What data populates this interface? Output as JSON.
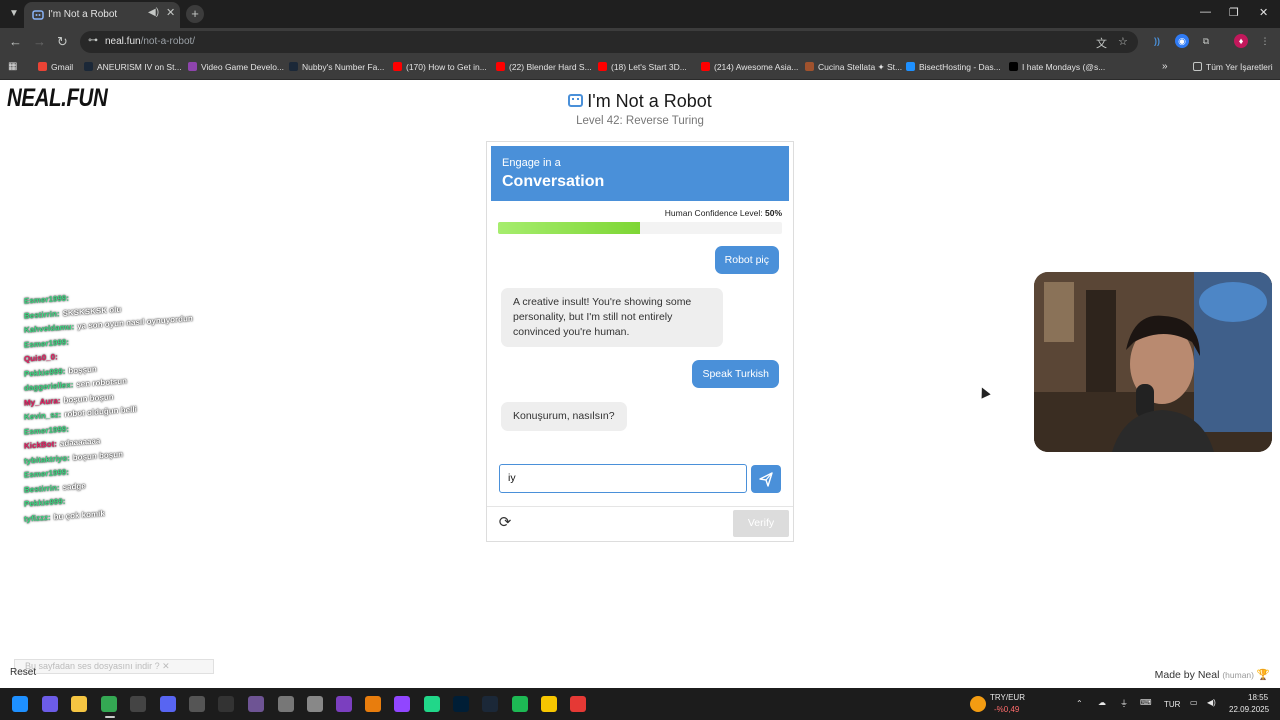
{
  "browser": {
    "tab": {
      "title": "I'm Not a Robot",
      "audio_icon": "speaker-icon",
      "close": "✕",
      "new_tab": "+"
    },
    "url": {
      "host": "neal.fun",
      "path": "/not-a-robot/"
    },
    "bookmarks": [
      {
        "label": "Gmail",
        "color": "#ea4335"
      },
      {
        "label": "ANEURISM IV on St...",
        "color": "#1b2838"
      },
      {
        "label": "Video Game Develo...",
        "color": "#8e44ad"
      },
      {
        "label": "Nubby's Number Fa...",
        "color": "#1b2838"
      },
      {
        "label": "(170) How to Get in...",
        "color": "#ff0000"
      },
      {
        "label": "(22) Blender Hard S...",
        "color": "#ff0000"
      },
      {
        "label": "(18) Let's Start 3D...",
        "color": "#ff0000"
      },
      {
        "label": "(214) Awesome Asia...",
        "color": "#ff0000"
      },
      {
        "label": "Cucina Stellata ✦ St...",
        "color": "#a0522d"
      },
      {
        "label": "BisectHosting - Das...",
        "color": "#1e90ff"
      },
      {
        "label": "I hate Mondays (@s...",
        "color": "#000000"
      }
    ],
    "bookmarks_overflow": "»",
    "all_bookmarks": "Tüm Yer İşaretleri"
  },
  "page": {
    "logo": "NEAL.FUN",
    "title": "I'm Not a Robot",
    "level": "Level 42: Reverse Turing",
    "card": {
      "header_sub": "Engage in a",
      "header_main": "Conversation",
      "confidence_label": "Human Confidence Level:",
      "confidence_value": "50%",
      "confidence_fraction": 0.5,
      "messages": [
        {
          "from": "user",
          "text": "Robot piç"
        },
        {
          "from": "bot",
          "lines": [
            "A creative insult! You're showing some",
            "personality, but I'm still not entirely",
            "convinced you're human."
          ]
        },
        {
          "from": "user",
          "text": "Speak Turkish"
        },
        {
          "from": "bot",
          "lines": [
            "Konuşurum, nasılsın?"
          ]
        }
      ],
      "input_value": "iy",
      "send_icon": "send-icon",
      "refresh_icon": "refresh-icon",
      "verify_label": "Verify"
    },
    "made_by": "Made by Neal",
    "made_by_tag": "(human)",
    "reset": "Reset",
    "audio_note": "Bu sayfadan ses dosyasını indir"
  },
  "stream_chat": [
    {
      "user": "Esmer1999:",
      "msg": "",
      "color": "#3ddc84"
    },
    {
      "user": "Bestirrin:",
      "msg": "SKSKSKSK olu",
      "color": "#3ddc84"
    },
    {
      "user": "Kahveldamu:",
      "msg": "ya son oyun nasıl oynuyordun",
      "color": "#3ddc84"
    },
    {
      "user": "Esmer1999:",
      "msg": "",
      "color": "#3ddc84"
    },
    {
      "user": "Quis0_0:",
      "msg": "",
      "color": "#e91e63"
    },
    {
      "user": "Pekkie999:",
      "msg": "boşşun",
      "color": "#3ddc84"
    },
    {
      "user": "daggeriellex:",
      "msg": "sen robotsun",
      "color": "#3ddc84"
    },
    {
      "user": "My_Aura:",
      "msg": "boşun boşun",
      "color": "#e91e63"
    },
    {
      "user": "Kevin_sz:",
      "msg": "robot olduğun belli",
      "color": "#3ddc84"
    },
    {
      "user": "Esmer1999:",
      "msg": "",
      "color": "#3ddc84"
    },
    {
      "user": "KickBot:",
      "msg": "adaaaaaaa",
      "color": "#e91e63"
    },
    {
      "user": "tybitaktriyo:",
      "msg": "boşun boşun",
      "color": "#3ddc84"
    },
    {
      "user": "Esmer1999:",
      "msg": "",
      "color": "#3ddc84"
    },
    {
      "user": "Bestirrin:",
      "msg": "sadge",
      "color": "#3ddc84"
    },
    {
      "user": "Pekkie999:",
      "msg": "",
      "color": "#3ddc84"
    },
    {
      "user": "tyfizzz:",
      "msg": "bu çok komik",
      "color": "#3ddc84"
    }
  ],
  "taskbar": {
    "currency": "TRY/EUR",
    "currency_change": "-%0,49",
    "lang": "TUR",
    "time": "18:55",
    "date": "22.09.2025"
  }
}
